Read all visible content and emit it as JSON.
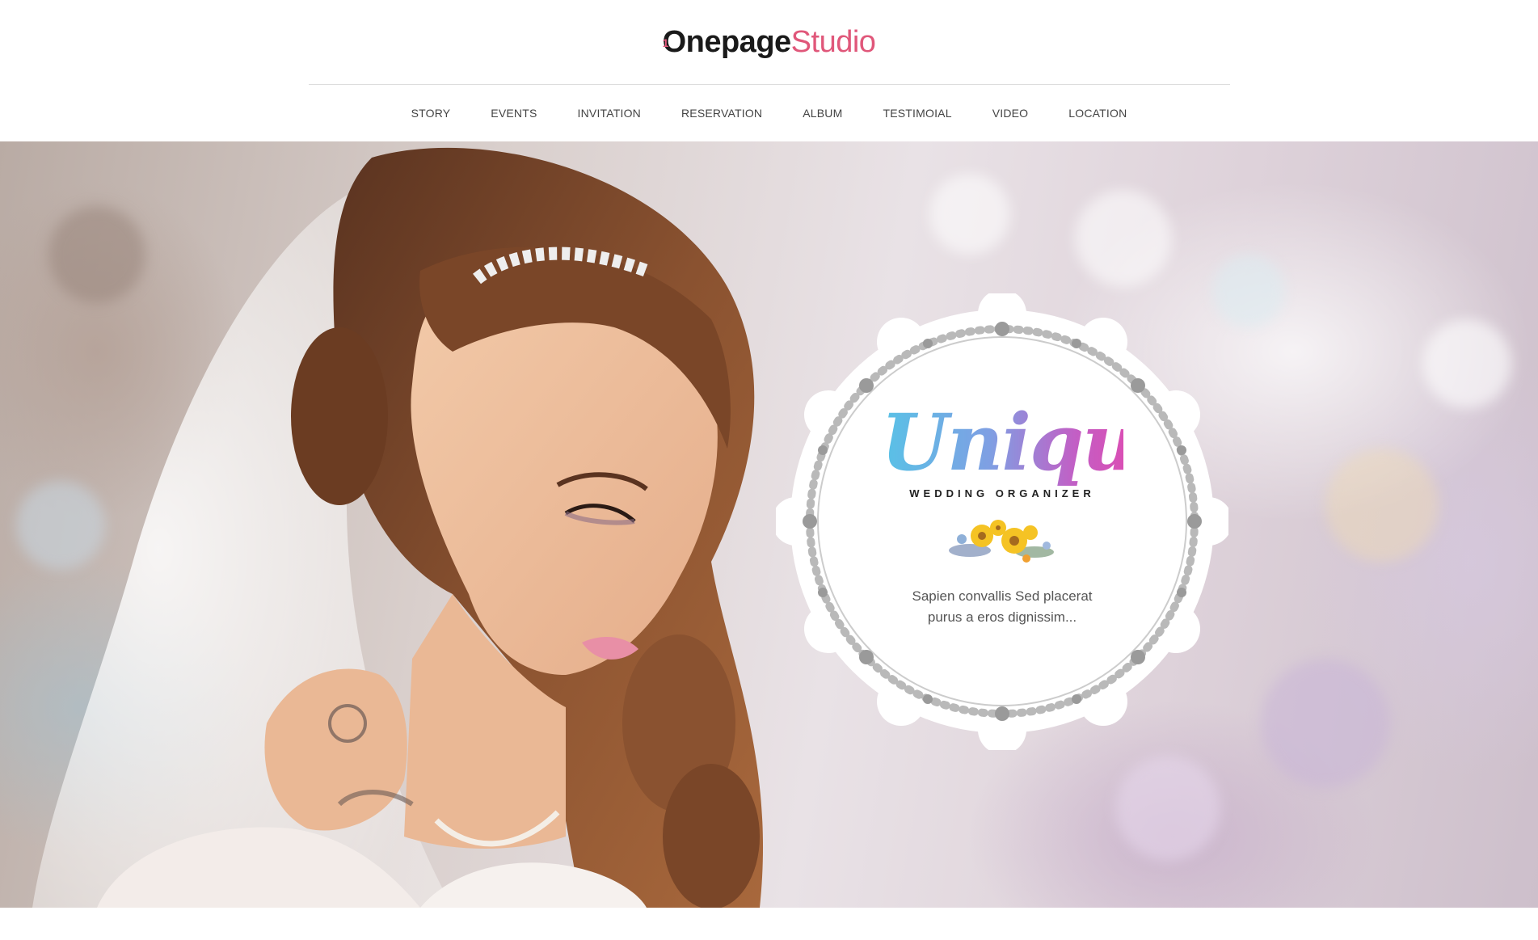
{
  "brand": {
    "logo_one_digit": "1",
    "logo_one": "O",
    "logo_dark": "nepage",
    "logo_pink": "Studio",
    "accent_color": "#e0577a"
  },
  "nav": {
    "items": [
      {
        "label": "STORY"
      },
      {
        "label": "EVENTS"
      },
      {
        "label": "INVITATION"
      },
      {
        "label": "RESERVATION"
      },
      {
        "label": "ALBUM"
      },
      {
        "label": "TESTIMOIAL"
      },
      {
        "label": "VIDEO"
      },
      {
        "label": "LOCATION"
      }
    ]
  },
  "hero": {
    "badge": {
      "title": "Unique",
      "subtitle": "WEDDING ORGANIZER",
      "text_line1": "Sapien convallis Sed placerat",
      "text_line2": "purus a eros dignissim..."
    },
    "gradient_colors": [
      "#58c2e6",
      "#c25fc5"
    ]
  }
}
